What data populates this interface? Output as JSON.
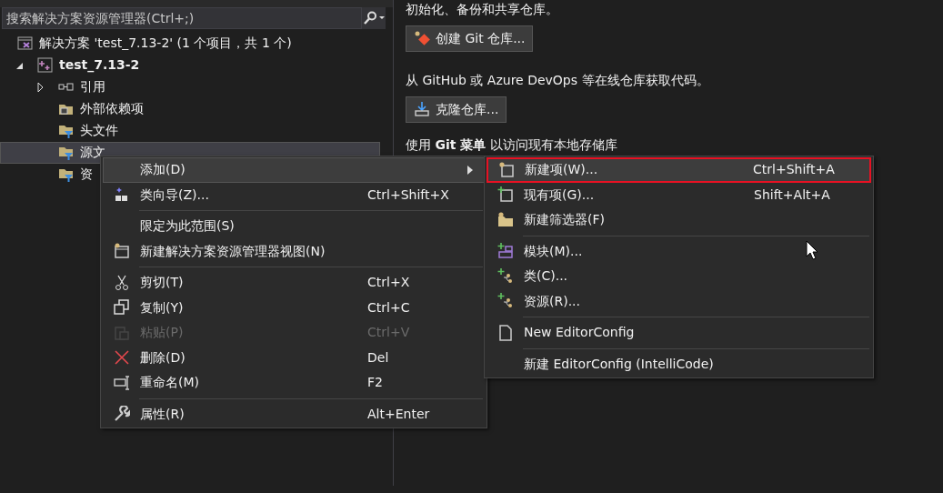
{
  "search": {
    "placeholder": "搜索解决方案资源管理器(Ctrl+;)"
  },
  "tree": [
    {
      "label": "解决方案 'test_7.13-2' (1 个项目，共 1 个)",
      "kind": "solution",
      "selected": false,
      "children": [
        {
          "label": "test_7.13-2",
          "kind": "project",
          "expanded": true,
          "selected": false,
          "children": [
            {
              "label": "引用",
              "kind": "references",
              "expanded": false,
              "selected": false
            },
            {
              "label": "外部依赖项",
              "kind": "external",
              "selected": false
            },
            {
              "label": "头文件",
              "kind": "filter",
              "selected": false
            },
            {
              "label": "源文",
              "kind": "filter",
              "selected": true
            },
            {
              "label": "资",
              "kind": "filter",
              "selected": false
            }
          ]
        }
      ]
    }
  ],
  "git_panel": {
    "intro": "初始化、备份和共享仓库。",
    "create_button": "创建 Git 仓库...",
    "clone_text": "从 GitHub 或 Azure DevOps 等在线仓库获取代码。",
    "clone_button": "克隆仓库...",
    "git_menu_text": "使用 **Git 菜单** 以访问现有本地存储库"
  },
  "context_menu": {
    "groups": [
      [
        {
          "label": "添加(D)",
          "submenu": true,
          "selected": true,
          "disabled": false
        },
        {
          "label": "类向导(Z)...",
          "shortcut": "Ctrl+Shift+X",
          "kind": "wizard",
          "selected": false,
          "disabled": false
        }
      ],
      [
        {
          "label": "限定为此范围(S)",
          "selected": false,
          "disabled": false
        },
        {
          "label": "新建解决方案资源管理器视图(N)",
          "kind": "newview",
          "selected": false,
          "disabled": false
        }
      ],
      [
        {
          "label": "剪切(T)",
          "shortcut": "Ctrl+X",
          "kind": "cut",
          "selected": false,
          "disabled": false
        },
        {
          "label": "复制(Y)",
          "shortcut": "Ctrl+C",
          "kind": "copy",
          "selected": false,
          "disabled": false
        },
        {
          "label": "粘贴(P)",
          "shortcut": "Ctrl+V",
          "kind": "paste",
          "selected": false,
          "disabled": true
        },
        {
          "label": "删除(D)",
          "shortcut": "Del",
          "kind": "delete",
          "selected": false,
          "disabled": false
        },
        {
          "label": "重命名(M)",
          "shortcut": "F2",
          "kind": "rename",
          "selected": false,
          "disabled": false
        }
      ],
      [
        {
          "label": "属性(R)",
          "shortcut": "Alt+Enter",
          "kind": "wrench",
          "selected": false,
          "disabled": false
        }
      ]
    ]
  },
  "submenu": {
    "groups": [
      [
        {
          "label": "新建项(W)...",
          "shortcut": "Ctrl+Shift+A",
          "kind": "newitem",
          "selected": true
        },
        {
          "label": "现有项(G)...",
          "shortcut": "Shift+Alt+A",
          "kind": "existing",
          "selected": false
        },
        {
          "label": "新建筛选器(F)",
          "kind": "newfilter",
          "selected": false
        }
      ],
      [
        {
          "label": "模块(M)...",
          "kind": "module",
          "selected": false
        },
        {
          "label": "类(C)...",
          "kind": "class",
          "selected": false
        },
        {
          "label": "资源(R)...",
          "kind": "class",
          "selected": false
        }
      ],
      [
        {
          "label": "New EditorConfig",
          "kind": "file",
          "selected": false
        }
      ],
      [
        {
          "label": "新建 EditorConfig (IntelliCode)",
          "selected": false
        }
      ]
    ]
  }
}
